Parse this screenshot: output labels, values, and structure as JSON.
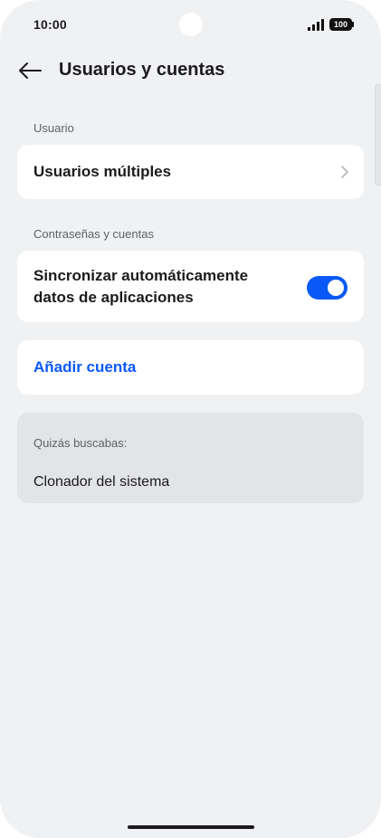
{
  "status_bar": {
    "time": "10:00",
    "battery": "100",
    "icons": [
      "signal-icon",
      "battery-icon"
    ]
  },
  "header": {
    "back_icon": "arrow-left-icon",
    "title": "Usuarios y cuentas"
  },
  "sections": {
    "user": {
      "label": "Usuario",
      "items": [
        {
          "label": "Usuarios múltiples",
          "icon": "chevron-right-icon"
        }
      ]
    },
    "accounts": {
      "label": "Contraseñas y cuentas",
      "sync": {
        "label_line1": "Sincronizar automáticamente",
        "label_line2": "datos de aplicaciones",
        "enabled": true
      }
    }
  },
  "add_account": {
    "label": "Añadir cuenta"
  },
  "suggestions": {
    "label": "Quizás buscabas:",
    "items": [
      "Clonador del sistema"
    ]
  },
  "colors": {
    "accent": "#0a59f7",
    "background": "#f0f1f3",
    "card": "#ffffff",
    "suggestion_card": "#e3e4e7"
  }
}
